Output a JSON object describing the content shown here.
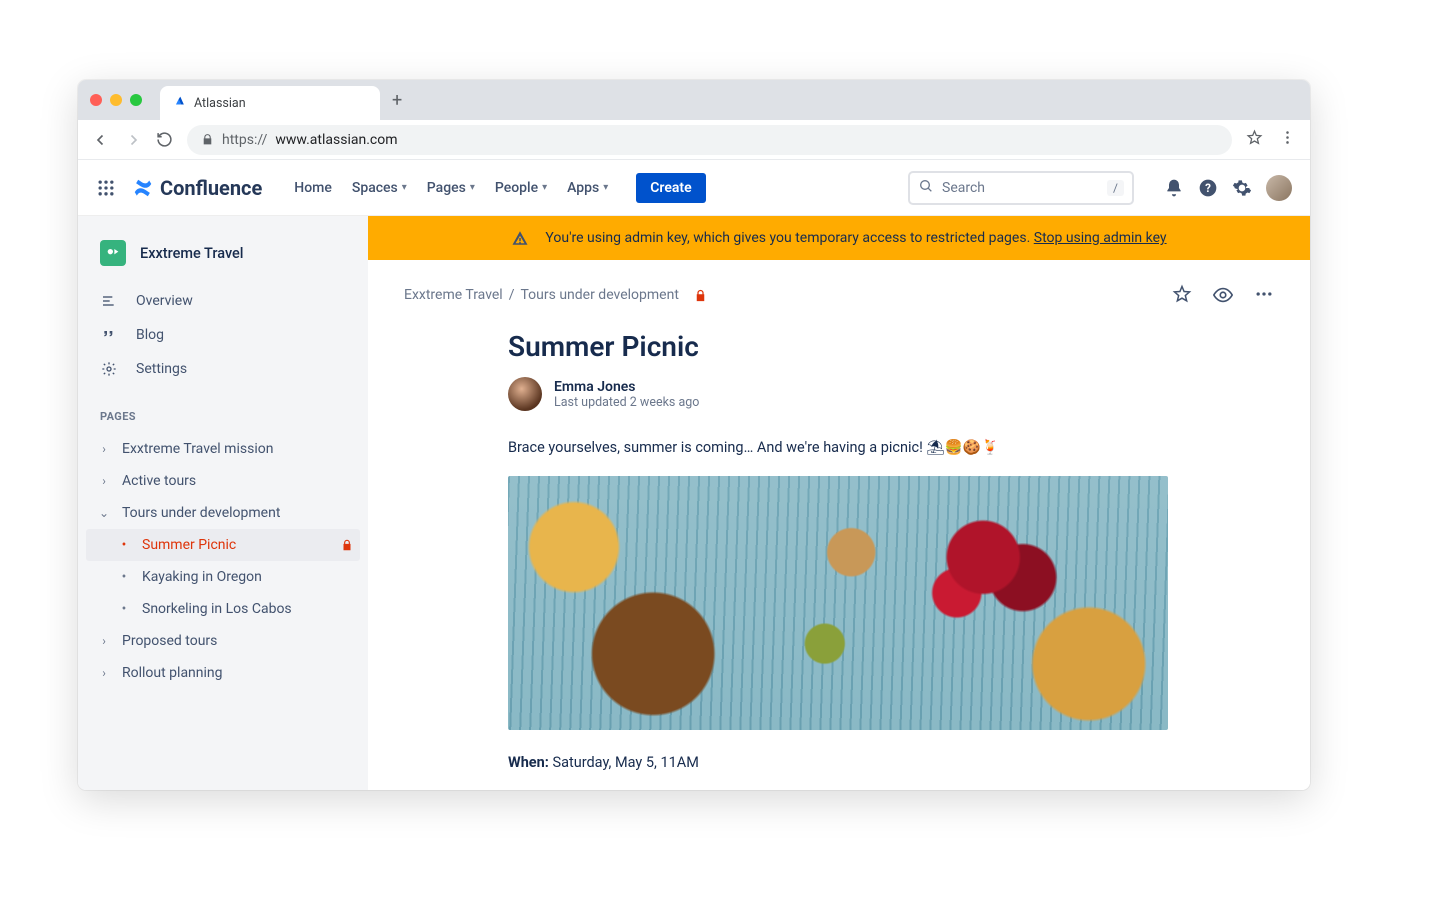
{
  "browser": {
    "tab_title": "Atlassian",
    "url_proto": "https://",
    "url_host": "www.atlassian.com"
  },
  "appnav": {
    "brand": "Confluence",
    "links": [
      "Home",
      "Spaces",
      "Pages",
      "People",
      "Apps"
    ],
    "create_label": "Create",
    "search_placeholder": "Search",
    "search_hint": "/"
  },
  "sidebar": {
    "space_name": "Exxtreme Travel",
    "items": [
      {
        "label": "Overview"
      },
      {
        "label": "Blog"
      },
      {
        "label": "Settings"
      }
    ],
    "section_label": "PAGES",
    "tree": [
      {
        "label": "Exxtreme Travel mission",
        "expanded": false,
        "children": []
      },
      {
        "label": "Active tours",
        "expanded": false,
        "children": []
      },
      {
        "label": "Tours under development",
        "expanded": true,
        "children": [
          {
            "label": "Summer Picnic",
            "active": true,
            "locked": true
          },
          {
            "label": "Kayaking in Oregon"
          },
          {
            "label": "Snorkeling in Los Cabos"
          }
        ]
      },
      {
        "label": "Proposed tours",
        "expanded": false,
        "children": []
      },
      {
        "label": "Rollout planning",
        "expanded": false,
        "children": []
      }
    ]
  },
  "banner": {
    "text": "You're using admin key, which gives you temporary access to restricted pages.",
    "link": "Stop using admin key"
  },
  "breadcrumb": {
    "space": "Exxtreme Travel",
    "sep": "/",
    "page": "Tours under development"
  },
  "page": {
    "title": "Summer Picnic",
    "author": "Emma Jones",
    "updated": "Last updated 2 weeks ago",
    "intro": "Brace yourselves, summer is coming… And we're having a picnic! ⛱🍔🍪🍹",
    "when_label": "When:",
    "when_value": "Saturday, May 5, 11AM"
  }
}
